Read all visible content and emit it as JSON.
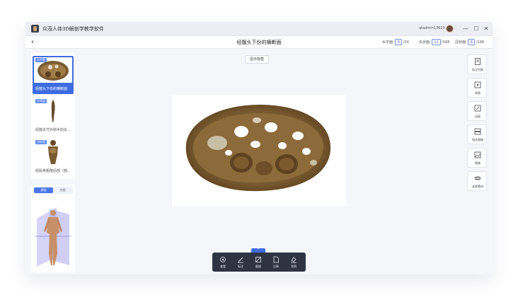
{
  "window": {
    "app_title": "众茂人体3D解剖学教学软件",
    "user_name": "qtadmin13623",
    "controls": {
      "minimize": "—",
      "maximize": "☐",
      "close": "✕"
    }
  },
  "toolbar": {
    "back_icon": "‹",
    "page_title": "经髋头下份的横断面",
    "axial_label": "水平面:",
    "axial_value": "6",
    "axial_total": "/24",
    "sagittal_label": "矢状面:",
    "sagittal_value": "12",
    "sagittal_total": "/168",
    "coronal_label": "冠状面:",
    "coronal_value": "8",
    "coronal_total": "/168"
  },
  "slices": [
    {
      "tag": "水平面",
      "caption": "经髋头下份的横断面",
      "active": true
    },
    {
      "tag": "矢状面",
      "caption": "经髋关节外侧半的矢…",
      "active": false
    },
    {
      "tag": "冠状面",
      "caption": "经股骨粗隆后部（髋…",
      "active": false
    }
  ],
  "navigator": {
    "tabs": [
      "原图",
      "文档"
    ],
    "active_tab": "原图"
  },
  "viewer": {
    "show_markers_label": "显示标签"
  },
  "right_tools": [
    {
      "label": "标注列表",
      "icon": "annotation-list-icon"
    },
    {
      "label": "视频",
      "icon": "video-icon"
    },
    {
      "label": "动画",
      "icon": "animation-icon"
    },
    {
      "label": "相关图像",
      "icon": "related-images-icon"
    },
    {
      "label": "图像",
      "icon": "image-icon"
    },
    {
      "label": "关联素材",
      "icon": "related-material-icon"
    }
  ],
  "bottom_tools": [
    {
      "label": "查看",
      "icon": "view-icon"
    },
    {
      "label": "标注",
      "icon": "annotate-icon"
    },
    {
      "label": "截图",
      "icon": "crop-icon"
    },
    {
      "label": "注释",
      "icon": "note-icon"
    },
    {
      "label": "涂鸦",
      "icon": "paint-icon"
    }
  ],
  "collapse_icon": "^",
  "colors": {
    "accent": "#3e6be0",
    "tissue": "#7a5a30",
    "bottom_bar": "#2f3442"
  }
}
